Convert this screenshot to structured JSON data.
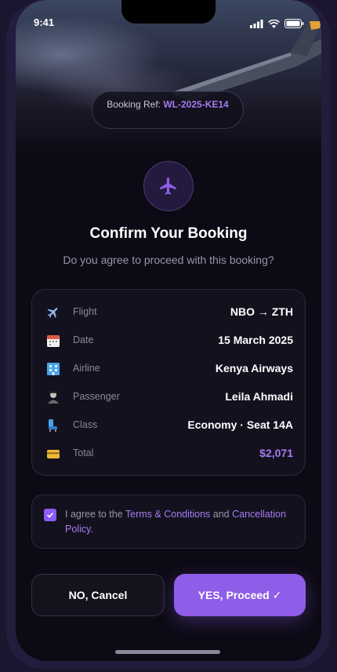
{
  "status_bar": {
    "time": "9:41"
  },
  "booking_ref": {
    "label": "Booking Ref:",
    "code": "WL-2025-KE14"
  },
  "header": {
    "title": "Confirm Your Booking",
    "subtitle": "Do you agree to proceed with this booking?"
  },
  "details": {
    "flight": {
      "label": "Flight",
      "value": "NBO → ZTH",
      "icon": "airplane-icon"
    },
    "date": {
      "label": "Date",
      "value": "15 March 2025",
      "icon": "calendar-icon"
    },
    "airline": {
      "label": "Airline",
      "value": "Kenya Airways",
      "icon": "building-icon"
    },
    "passenger": {
      "label": "Passenger",
      "value": "Leila Ahmadi",
      "icon": "passenger-icon"
    },
    "class": {
      "label": "Class",
      "value": "Economy · Seat 14A",
      "icon": "seat-icon"
    },
    "total": {
      "label": "Total",
      "value": "$2,071",
      "icon": "credit-card-icon"
    }
  },
  "agreement": {
    "checked": true,
    "prefix": "I agree to the ",
    "terms_link": "Terms & Conditions",
    "middle": " and ",
    "policy_link": "Cancellation Policy",
    "suffix": "."
  },
  "actions": {
    "cancel_label": "NO, Cancel",
    "proceed_label": "YES, Proceed ✓"
  },
  "colors": {
    "accent": "#8f5ee8",
    "accent_text": "#a57cf0",
    "background": "#0c0a14"
  }
}
